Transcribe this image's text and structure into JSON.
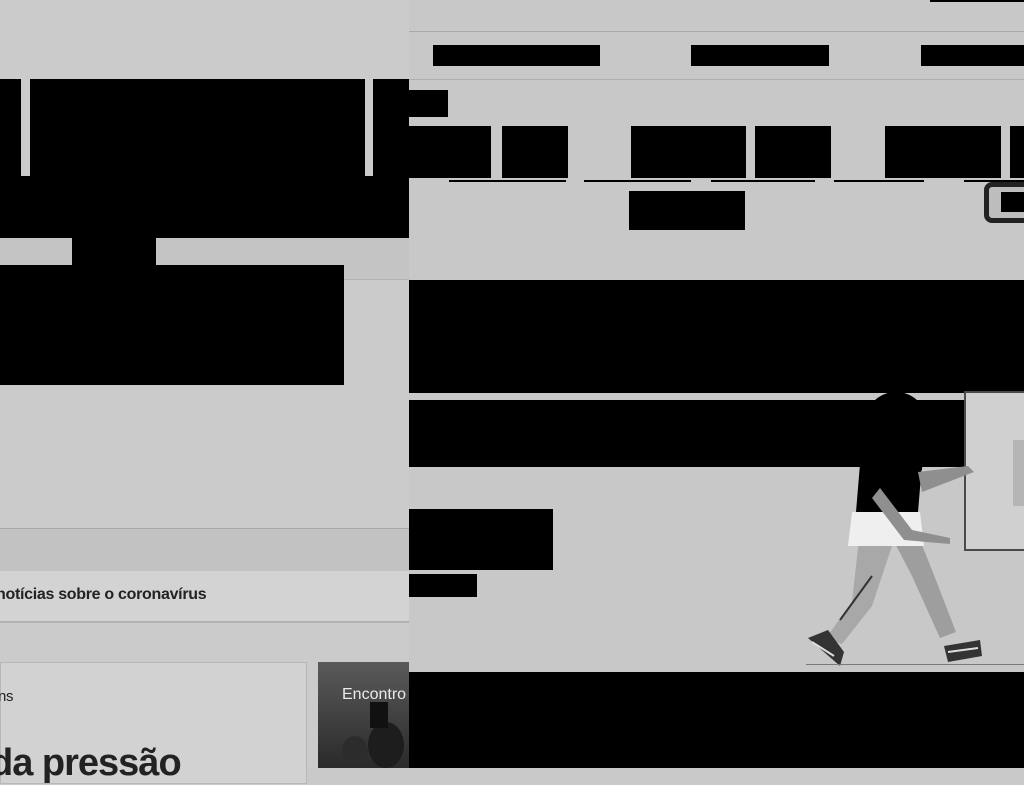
{
  "left_page": {
    "corona_link": "notícias sobre o coronavírus",
    "news_card": {
      "small_text": "ns",
      "headline": "da pressão"
    },
    "photo_card": {
      "caption": "Encontro"
    }
  },
  "right_page": {
    "illustration": "person-walking-illustration"
  },
  "colors": {
    "background": "#c9c9c9",
    "redaction": "#000000",
    "text": "#222222"
  }
}
